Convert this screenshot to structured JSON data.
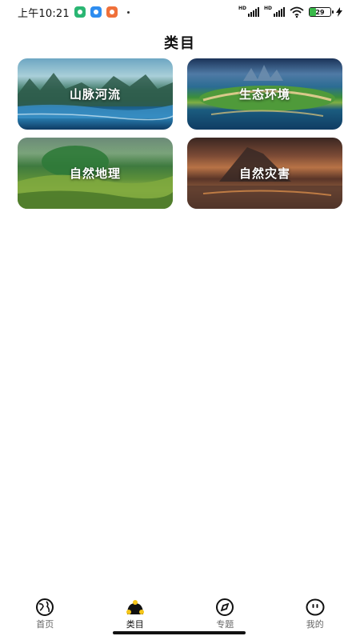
{
  "status_bar": {
    "time": "上午10:21",
    "battery_level": "29",
    "network_left": "HD",
    "network_right": "HD"
  },
  "page": {
    "title": "类目"
  },
  "categories": [
    {
      "label": "山脉河流",
      "image": "mountains-rivers-landscape"
    },
    {
      "label": "生态环境",
      "image": "ecological-island-landscape"
    },
    {
      "label": "自然地理",
      "image": "green-hills-landscape"
    },
    {
      "label": "自然灾害",
      "image": "volcano-landscape"
    }
  ],
  "bottom_nav": {
    "active": "类目",
    "items": [
      {
        "label": "首页",
        "icon": "globe-icon"
      },
      {
        "label": "类目",
        "icon": "category-icon"
      },
      {
        "label": "专题",
        "icon": "compass-icon"
      },
      {
        "label": "我的",
        "icon": "profile-face-icon"
      }
    ]
  },
  "colors": {
    "accent": "#f5c518",
    "battery": "#3ab94a"
  }
}
